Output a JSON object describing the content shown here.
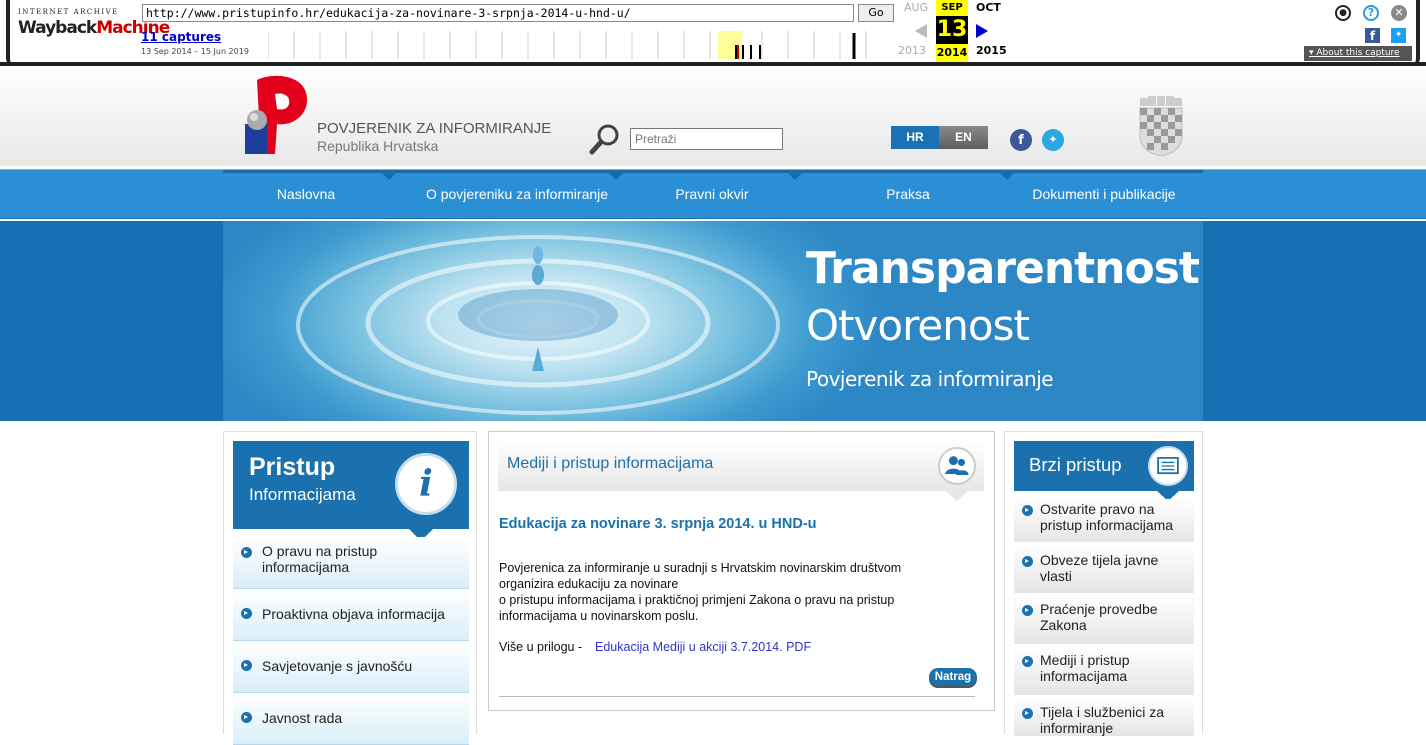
{
  "wayback": {
    "logo_top": "INTERNET ARCHIVE",
    "logo_word_a": "Wayback",
    "logo_word_b": "Machine",
    "url": "http://www.pristupinfo.hr/edukacija-za-novinare-3-srpnja-2014-u-hnd-u/",
    "go_label": "Go",
    "captures": "11 captures",
    "range": "13 Sep 2014 – 15 Jun 2019",
    "prev_month": "AUG",
    "cur_month": "SEP",
    "next_month": "OCT",
    "cur_day": "13",
    "prev_year": "2013",
    "cur_year": "2014",
    "next_year": "2015",
    "about_label": "About this capture"
  },
  "header": {
    "org_name": "POVJERENIK ZA INFORMIRANJE",
    "org_sub": "Republika Hrvatska",
    "search_placeholder": "Pretraži",
    "lang_hr": "HR",
    "lang_en": "EN"
  },
  "nav": {
    "items": [
      "Naslovna",
      "O povjereniku za informiranje",
      "Pravni okvir",
      "Praksa",
      "Dokumenti i publikacije"
    ]
  },
  "hero": {
    "line1": "Transparentnost",
    "line2": "Otvorenost",
    "line3": "Povjerenik za informiranje"
  },
  "left": {
    "title": "Pristup",
    "subtitle": "Informacijama",
    "items": [
      {
        "line1": "O pravu na pristup",
        "line2": "informacijama"
      },
      {
        "line1": "Proaktivna objava informacija",
        "line2": ""
      },
      {
        "line1": "Savjetovanje s javnošću",
        "line2": ""
      },
      {
        "line1": "Javnost rada",
        "line2": ""
      }
    ]
  },
  "center": {
    "section_title": "Mediji i pristup informacijama",
    "article_title": "Edukacija za novinare 3. srpnja 2014. u HND-u",
    "p1": "Povjerenica za informiranje u suradnji s Hrvatskim novinarskim društvom",
    "p2": "organizira edukaciju za novinare",
    "p3": "o pristupu informacijama i praktičnoj primjeni Zakona o pravu na pristup",
    "p4": "informacijama u novinarskom poslu.",
    "more_label": "Više u prilogu  -",
    "attachment": "Edukacija Mediji u akciji 3.7.2014. PDF",
    "back_label": "Natrag"
  },
  "right": {
    "title": "Brzi pristup",
    "items": [
      {
        "line1": "Ostvarite pravo na",
        "line2": "pristup informacijama"
      },
      {
        "line1": "Obveze tijela javne",
        "line2": "vlasti"
      },
      {
        "line1": "Praćenje provedbe",
        "line2": "Zakona"
      },
      {
        "line1": "Mediji i pristup",
        "line2": "informacijama"
      },
      {
        "line1": "Tijela i službenici za",
        "line2": "informiranje"
      }
    ]
  },
  "colors": {
    "brand_blue": "#1a71ad",
    "nav_blue": "#2a8fd4",
    "logo_red": "#e3001b"
  }
}
